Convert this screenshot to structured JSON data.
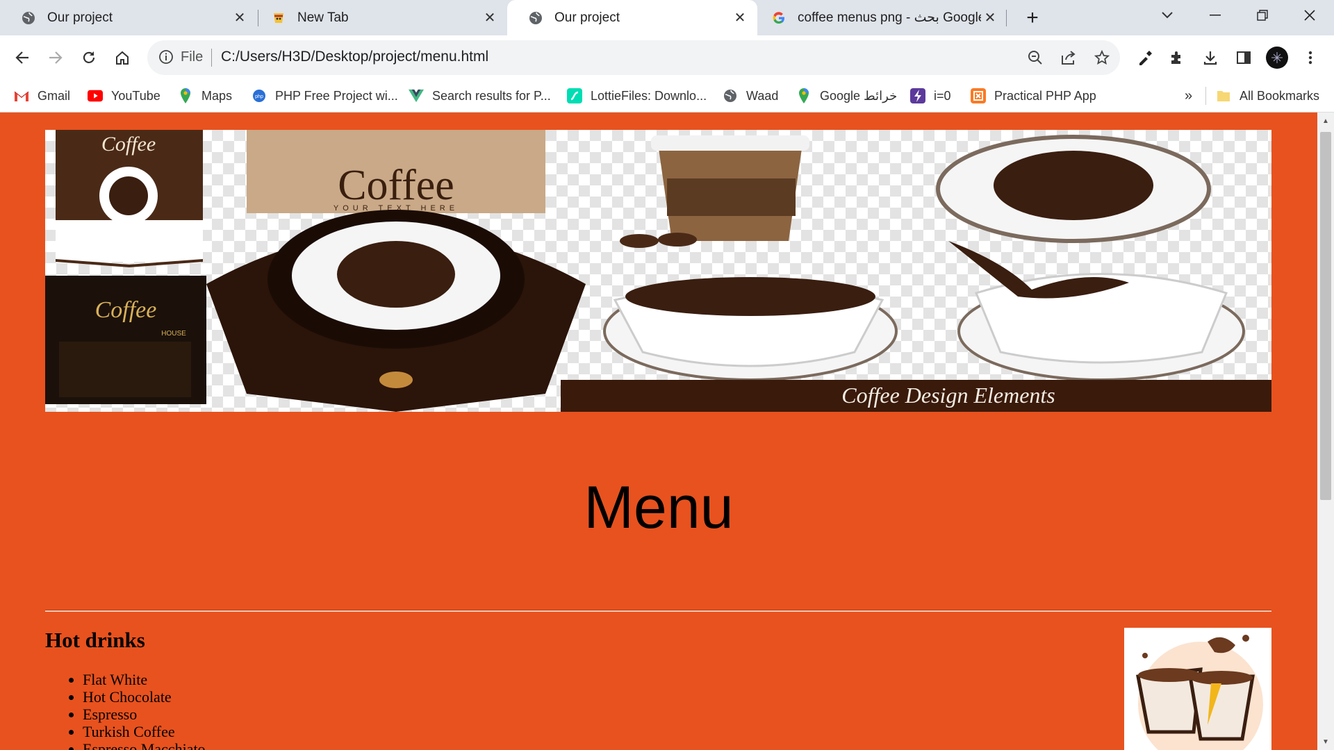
{
  "browser": {
    "tabs": [
      {
        "title": "Our project",
        "icon": "globe-icon",
        "active": false
      },
      {
        "title": "New Tab",
        "icon": "newtab-cup-icon",
        "active": false
      },
      {
        "title": "Our project",
        "icon": "globe-icon",
        "active": true
      },
      {
        "title": "coffee menus png - بحث Google",
        "icon": "google-icon",
        "active": false
      }
    ],
    "address": {
      "scheme_label": "File",
      "url": "C:/Users/H3D/Desktop/project/menu.html"
    },
    "bookmarks": [
      {
        "label": "Gmail",
        "icon": "gmail-icon"
      },
      {
        "label": "YouTube",
        "icon": "youtube-icon"
      },
      {
        "label": "Maps",
        "icon": "maps-icon"
      },
      {
        "label": "PHP Free Project wi...",
        "icon": "php-icon"
      },
      {
        "label": "Search results for P...",
        "icon": "vue-icon"
      },
      {
        "label": "LottieFiles: Downlo...",
        "icon": "lottie-icon"
      },
      {
        "label": "Waad",
        "icon": "globe-icon"
      },
      {
        "label": "Google خرائط",
        "icon": "maps-icon"
      },
      {
        "label": "i=0",
        "icon": "bolt-icon"
      },
      {
        "label": "Practical PHP App",
        "icon": "xampp-icon"
      }
    ],
    "bookmarks_overflow": "»",
    "all_bookmarks": "All Bookmarks"
  },
  "page": {
    "banner_text": "Coffee Design Elements",
    "banner_brand": "Coffee",
    "banner_brand_sub": "YOUR TEXT HERE",
    "banner_house": "HOUSE",
    "title": "Menu",
    "section": "Hot drinks",
    "items": [
      "Flat White",
      "Hot Chocolate",
      "Espresso",
      "Turkish Coffee",
      "Espresso Macchiato"
    ]
  },
  "colors": {
    "page_bg": "#e8521e",
    "chrome_bg": "#dfe3ea",
    "coffee_dark": "#4a2a17"
  }
}
